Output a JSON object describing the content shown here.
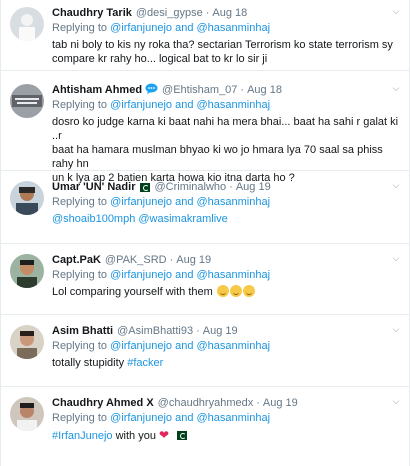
{
  "tweets": [
    {
      "name": "Chaudhry Tarik",
      "handle": "@desi_gypse",
      "time": "Aug 18",
      "replying_prefix": "Replying to",
      "replying_to": "@irfanjunejo and @hasanminhaj",
      "lines": [
        "tab ni boly to kis ny roka tha? sectarian Terrorism ko state terrorism sy",
        "compare kr rahy ho... logical bat to kr lo sir ji"
      ]
    },
    {
      "name": "Ahtisham Ahmed",
      "handle": "@Ehtisham_07",
      "time": "Aug 18",
      "replying_prefix": "Replying to",
      "replying_to": "@irfanjunejo and @hasanminhaj",
      "lines": [
        "dosro ko judge karna ki baat nahi ha mera bhai... baat ha sahi r galat ki ..r",
        "baat ha hamara muslman bhyao ki wo jo hmara lya 70 saal sa phiss rahy hn",
        "un k lya ap 2 batien karta howa kio itna darta ho ?"
      ]
    },
    {
      "name": "Umar 'UN' Nadir",
      "handle": "@Criminalwho",
      "time": "Aug 19",
      "replying_prefix": "Replying to",
      "replying_to": "@irfanjunejo and @hasanminhaj",
      "mentions": "@shoaib100mph @wasimakramlive"
    },
    {
      "name": "Capt.PaK",
      "handle": "@PAK_SRD",
      "time": "Aug 19",
      "replying_prefix": "Replying to",
      "replying_to": "@irfanjunejo and @hasanminhaj",
      "text": "Lol comparing yourself with them"
    },
    {
      "name": "Asim Bhatti",
      "handle": "@AsimBhatti93",
      "time": "Aug 19",
      "replying_prefix": "Replying to",
      "replying_to": "@irfanjunejo and @hasanminhaj",
      "text": "totally stupidity",
      "hashtag": "#facker"
    },
    {
      "name": "Chaudhry Ahmed X",
      "handle": "@chaudhryahmedx",
      "time": "Aug 19",
      "replying_prefix": "Replying to",
      "replying_to": "@irfanjunejo and @hasanminhaj",
      "hashtag": "#IrfanJunejo",
      "text": "with you"
    }
  ],
  "separator": "·",
  "colors": {
    "link": "#1b95e0",
    "muted": "#657786",
    "border": "#e6ecf0"
  },
  "icons": {
    "more": "chevron-down-icon",
    "badge": "speech-bubble-icon",
    "flag": "pakistan-flag-icon",
    "emoji": "rolling-laughing-emoji-icon",
    "heart": "red-heart-icon"
  }
}
